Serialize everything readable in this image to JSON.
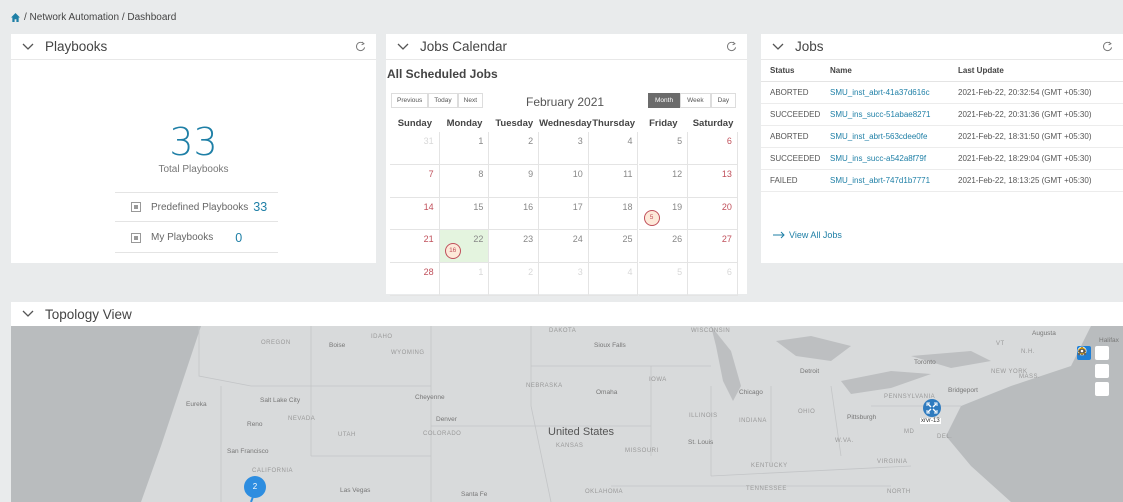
{
  "breadcrumb": {
    "path": "/ Network Automation / Dashboard",
    "icon": "home-icon"
  },
  "playbooks": {
    "title": "Playbooks",
    "total": "33",
    "total_label": "Total Playbooks",
    "rows": [
      {
        "label": "Predefined Playbooks",
        "count": "33"
      },
      {
        "label": "My Playbooks",
        "count": "0"
      }
    ]
  },
  "calendar": {
    "title": "Jobs Calendar",
    "subtitle": "All Scheduled Jobs",
    "nav": [
      "Previous",
      "Today",
      "Next"
    ],
    "month": "February 2021",
    "views": [
      "Month",
      "Week",
      "Day"
    ],
    "active_view": "Month",
    "days_of_week": [
      "Sunday",
      "Monday",
      "Tuesday",
      "Wednesday",
      "Thursday",
      "Friday",
      "Saturday"
    ],
    "weeks": [
      [
        "31",
        "1",
        "2",
        "3",
        "4",
        "5",
        "6"
      ],
      [
        "7",
        "8",
        "9",
        "10",
        "11",
        "12",
        "13"
      ],
      [
        "14",
        "15",
        "16",
        "17",
        "18",
        "19",
        "20"
      ],
      [
        "21",
        "22",
        "23",
        "24",
        "25",
        "26",
        "27"
      ],
      [
        "28",
        "1",
        "2",
        "3",
        "4",
        "5",
        "6"
      ]
    ],
    "today": "22",
    "events": [
      {
        "day": "19",
        "count": "5"
      },
      {
        "day": "22",
        "count": "16"
      }
    ]
  },
  "jobs": {
    "title": "Jobs",
    "columns": [
      "Status",
      "Name",
      "Last Update"
    ],
    "rows": [
      {
        "status": "ABORTED",
        "name": "SMU_inst_abrt-41a37d616c",
        "updated": "2021-Feb-22, 20:32:54 (GMT +05:30)"
      },
      {
        "status": "SUCCEEDED",
        "name": "SMU_ins_succ-51abae8271",
        "updated": "2021-Feb-22, 20:31:36 (GMT +05:30)"
      },
      {
        "status": "ABORTED",
        "name": "SMU_inst_abrt-563cdee0fe",
        "updated": "2021-Feb-22, 18:31:50 (GMT +05:30)"
      },
      {
        "status": "SUCCEEDED",
        "name": "SMU_ins_succ-a542a8f79f",
        "updated": "2021-Feb-22, 18:29:04 (GMT +05:30)"
      },
      {
        "status": "FAILED",
        "name": "SMU_inst_abrt-747d1b7771",
        "updated": "2021-Feb-22, 18:13:25 (GMT +05:30)"
      }
    ],
    "view_all": "View All Jobs"
  },
  "topology": {
    "title": "Topology View",
    "cluster_count": "2",
    "node_label": "xrvr-13",
    "map_labels": {
      "dakota": "DAKOTA",
      "wisconsin": "WISCONSIN",
      "idaho": "IDAHO",
      "oregon": "OREGON",
      "boise": "Boise",
      "wyoming": "WYOMING",
      "sioux_falls": "Sioux Falls",
      "nebraska": "NEBRASKA",
      "omaha": "Omaha",
      "iowa": "IOWA",
      "cheyenne": "Cheyenne",
      "chicago": "Chicago",
      "detroit": "Detroit",
      "toronto": "Toronto",
      "new_york": "NEW YORK",
      "augusta": "Augusta",
      "halifax": "Halifax",
      "vt": "VT",
      "nh": "N.H.",
      "mass": "MASS.",
      "eureka": "Eureka",
      "salt_lake": "Salt Lake City",
      "reno": "Reno",
      "nevada": "NEVADA",
      "utah": "UTAH",
      "denver": "Denver",
      "colorado": "COLORADO",
      "kansas": "KANSAS",
      "united_states": "United States",
      "illinois": "ILLINOIS",
      "indiana": "INDIANA",
      "ohio": "OHIO",
      "pennsylvania": "PENNSYLVANIA",
      "pittsburgh": "Pittsburgh",
      "bridgeport": "Bridgeport",
      "md": "MD",
      "del": "DEL.",
      "st_louis": "St. Louis",
      "missouri": "MISSOURI",
      "wva": "W.VA.",
      "virginia": "VIRGINIA",
      "kentucky": "KENTUCKY",
      "san_francisco": "San Francisco",
      "california": "CALIFORNIA",
      "las_vegas": "Las Vegas",
      "santa_fe": "Santa Fe",
      "oklahoma": "OKLAHOMA",
      "tennessee": "TENNESSEE",
      "north": "NORTH"
    }
  }
}
